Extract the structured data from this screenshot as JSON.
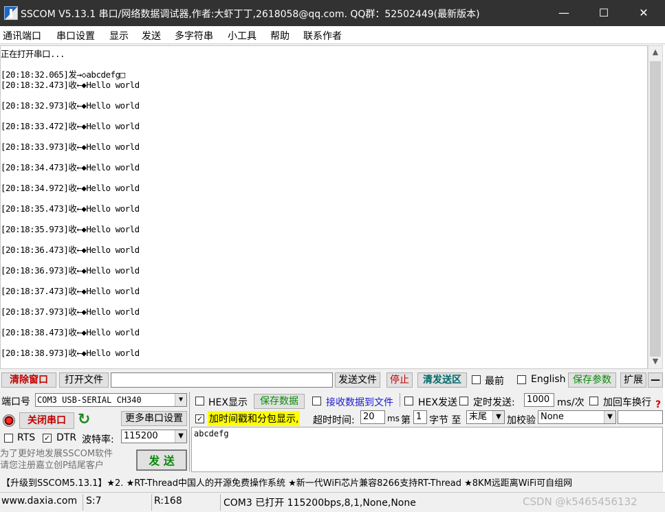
{
  "window": {
    "title": "SSCOM V5.13.1 串口/网络数据调试器,作者:大虾丁丁,2618058@qq.com. QQ群：52502449(最新版本)",
    "minimize": "—",
    "maximize": "☐",
    "close": "✕"
  },
  "menu": [
    "通讯端口",
    "串口设置",
    "显示",
    "发送",
    "多字符串",
    "小工具",
    "帮助",
    "联系作者"
  ],
  "receive": {
    "lines": [
      "正在打开串口...",
      "",
      "[20:18:32.065]发→◇abcdefg□",
      "[20:18:32.473]收←◆Hello world",
      "",
      "[20:18:32.973]收←◆Hello world",
      "",
      "[20:18:33.472]收←◆Hello world",
      "",
      "[20:18:33.973]收←◆Hello world",
      "",
      "[20:18:34.473]收←◆Hello world",
      "",
      "[20:18:34.972]收←◆Hello world",
      "",
      "[20:18:35.473]收←◆Hello world",
      "",
      "[20:18:35.973]收←◆Hello world",
      "",
      "[20:18:36.473]收←◆Hello world",
      "",
      "[20:18:36.973]收←◆Hello world",
      "",
      "[20:18:37.473]收←◆Hello world",
      "",
      "[20:18:37.973]收←◆Hello world",
      "",
      "[20:18:38.473]收←◆Hello world",
      "",
      "[20:18:38.973]收←◆Hello world"
    ]
  },
  "toolbar": {
    "clear_window": "清除窗口",
    "open_file": "打开文件",
    "file_path": "",
    "send_file": "发送文件",
    "stop": "停止",
    "clear_send": "清发送区",
    "topmost": "最前",
    "english": "English",
    "save_params": "保存参数",
    "expand": "扩展",
    "collapse": "—"
  },
  "port": {
    "port_label": "端口号",
    "port_value": "COM3 USB-SERIAL CH340",
    "close_port": "关闭串口",
    "more_settings": "更多串口设置",
    "rts": "RTS",
    "dtr": "DTR",
    "baud_label": "波特率:",
    "baud_value": "115200"
  },
  "options": {
    "hex_display": "HEX显示",
    "save_data": "保存数据",
    "recv_to_file": "接收数据到文件",
    "hex_send": "HEX发送",
    "timed_send": "定时发送:",
    "timed_value": "1000",
    "timed_unit": "ms/次",
    "add_crlf": "加回车换行",
    "timestamp": "加时间戳和分包显示,",
    "timeout_label": "超时时间:",
    "timeout_value": "20",
    "timeout_unit": "ms",
    "byte_prefix": "第",
    "byte_index": "1",
    "byte_label": "字节 至",
    "byte_end": "末尾",
    "checksum_label": "加校验",
    "checksum_value": "None",
    "help": "?"
  },
  "send": {
    "text": "abcdefg",
    "button": "发  送",
    "promo": "为了更好地发展SSCOM软件\n请您注册嘉立创P结尾客户"
  },
  "ticker": "【升级到SSCOM5.13.1】★2. ★RT-Thread中国人的开源免费操作系统 ★新一代WiFi芯片兼容8266支持RT-Thread ★8KM远距离WiFi可自组网",
  "status": {
    "site": "www.daxia.com",
    "sent": "S:7",
    "received": "R:168",
    "port_state": "COM3 已打开  115200bps,8,1,None,None",
    "watermark": "CSDN @k5465456132"
  }
}
